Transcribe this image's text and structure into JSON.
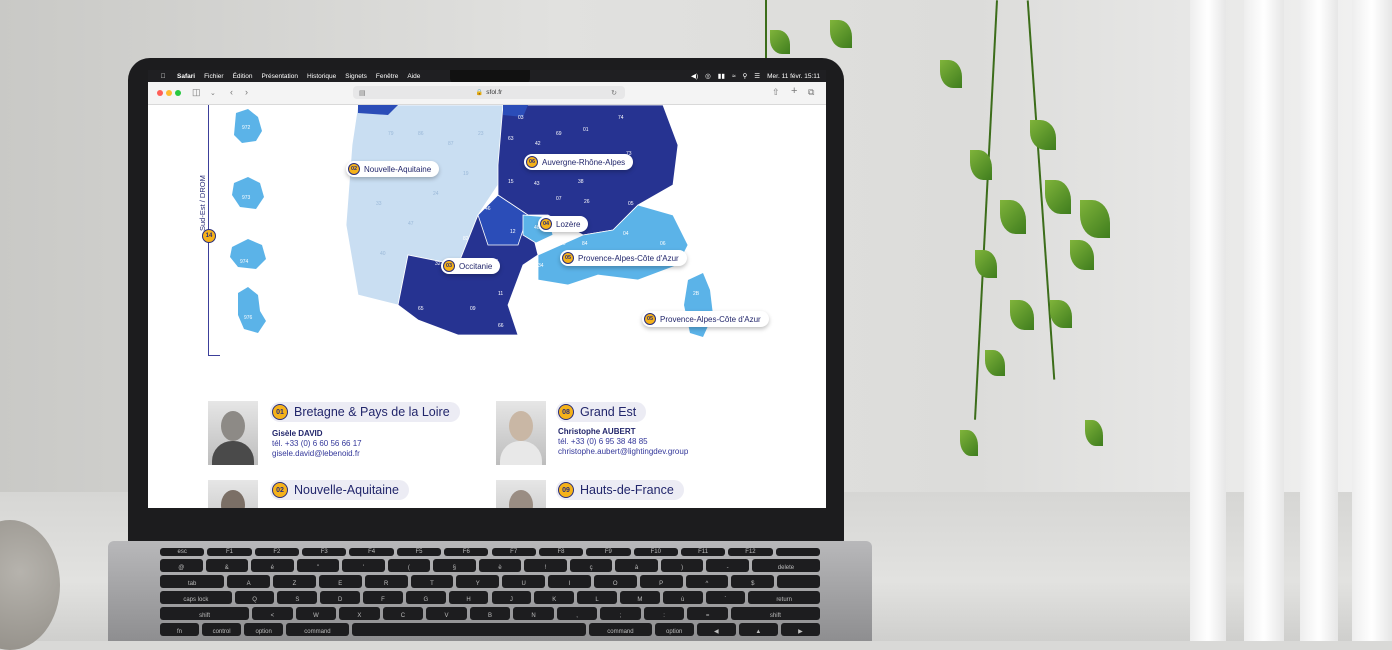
{
  "menubar": {
    "app": "Safari",
    "items": [
      "Fichier",
      "Édition",
      "Présentation",
      "Historique",
      "Signets",
      "Fenêtre",
      "Aide"
    ],
    "clock": "Mer. 11 févr. 15:11"
  },
  "toolbar": {
    "url": "sfol.fr"
  },
  "sidebar": {
    "label": "Sud-Est / DROM",
    "badge": "14"
  },
  "map": {
    "colors": {
      "dark": "#263391",
      "mid": "#2b4db8",
      "light": "#5bb3e8",
      "pale": "#c9def2"
    },
    "labels": [
      {
        "num": "02",
        "name": "Nouvelle-Aquitaine"
      },
      {
        "num": "06",
        "name": "Auvergne-Rhône-Alpes"
      },
      {
        "num": "04",
        "name": "Lozère"
      },
      {
        "num": "03",
        "name": "Occitanie"
      },
      {
        "num": "05",
        "name": "Provence-Alpes-Côte d'Azur"
      },
      {
        "num": "05",
        "name": "Provence-Alpes-Côte d'Azur"
      }
    ],
    "depts": [
      "03",
      "69",
      "01",
      "74",
      "63",
      "42",
      "73",
      "43",
      "15",
      "38",
      "07",
      "26",
      "46",
      "12",
      "05",
      "04",
      "06",
      "48",
      "84",
      "83",
      "82",
      "30",
      "13",
      "34",
      "32",
      "31",
      "81",
      "11",
      "09",
      "65",
      "66",
      "2B",
      "2A",
      "972",
      "973",
      "974",
      "976",
      "40",
      "47",
      "33",
      "24",
      "19",
      "87",
      "16",
      "17",
      "79",
      "86",
      "23"
    ]
  },
  "contacts": [
    {
      "num": "01",
      "region": "Bretagne & Pays de la Loire",
      "name": "Gisèle DAVID",
      "tel": "tél. +33 (0) 6 60 56 66 17",
      "email": "gisele.david@lebenoid.fr"
    },
    {
      "num": "08",
      "region": "Grand Est",
      "name": "Christophe AUBERT",
      "tel": "tél. +33 (0) 6 95 38 48 85",
      "email": "christophe.aubert@lightingdev.group"
    },
    {
      "num": "02",
      "region": "Nouvelle-Aquitaine"
    },
    {
      "num": "09",
      "region": "Hauts-de-France"
    }
  ],
  "keyboard": {
    "row1": [
      "esc",
      "F1",
      "F2",
      "F3",
      "F4",
      "F5",
      "F6",
      "F7",
      "F8",
      "F9",
      "F10",
      "F11",
      "F12",
      ""
    ],
    "row2": [
      "@",
      "&",
      "é",
      "\"",
      "'",
      "(",
      "§",
      "è",
      "!",
      "ç",
      "à",
      ")",
      "-",
      "delete"
    ],
    "row3": [
      "tab",
      "A",
      "Z",
      "E",
      "R",
      "T",
      "Y",
      "U",
      "I",
      "O",
      "P",
      "^",
      "$",
      ""
    ],
    "row4": [
      "caps lock",
      "Q",
      "S",
      "D",
      "F",
      "G",
      "H",
      "J",
      "K",
      "L",
      "M",
      "ù",
      "`",
      "return"
    ],
    "row5": [
      "shift",
      "<",
      "W",
      "X",
      "C",
      "V",
      "B",
      "N",
      ",",
      ";",
      ":",
      "=",
      "shift"
    ],
    "row6": [
      "fn",
      "control",
      "option",
      "command",
      "",
      "command",
      "option",
      "◀",
      "▲",
      "▶"
    ]
  }
}
